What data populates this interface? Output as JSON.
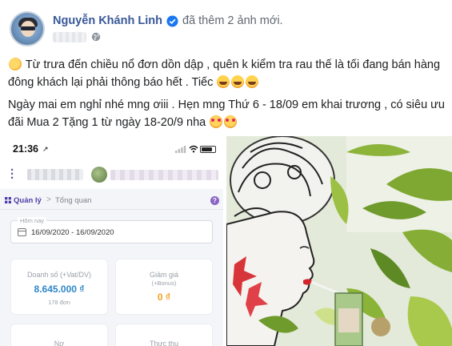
{
  "post": {
    "author": "Nguyễn Khánh Linh",
    "action": "đã thêm 2 ảnh mới.",
    "paragraph1": "Từ trưa đến chiều nổ đơn dồn dập , quên k kiểm tra rau thế là tối đang bán hàng đông khách lại phải thông báo hết . Tiếc",
    "paragraph2": "Ngày mai em nghỉ nhé mng ơiii . Hẹn mng Thứ 6 - 18/09 em khai trương , có siêu ưu đãi Mua 2 Tặng 1 từ ngày 18-20/9 nha",
    "icons": [
      "verified-icon",
      "globe-icon",
      "party-emoji",
      "laugh-emoji",
      "heart-eyes-emoji"
    ]
  },
  "phone": {
    "status_time": "21:36",
    "location_arrow": "↗",
    "breadcrumb_manage": "Quản lý",
    "breadcrumb_sep": ">",
    "breadcrumb_overview": "Tổng quan",
    "help": "?",
    "date_label": "Hôm nay",
    "date_range": "16/09/2020  -  16/09/2020",
    "cards": [
      {
        "title": "Doanh số (+Vat/DV)",
        "value": "8.645.000 ₫",
        "sub": "178 đơn"
      },
      {
        "title": "Giảm giá",
        "sub": "(+Bonus)",
        "value": "0 ₫"
      },
      {
        "title": "Nợ"
      },
      {
        "title": "Thực thu"
      }
    ],
    "colors": {
      "accent": "#4e3ca8",
      "value_blue": "#2f86c8",
      "value_orange": "#f0a020"
    }
  },
  "colors": {
    "author_link": "#385898",
    "muted": "#606770"
  }
}
